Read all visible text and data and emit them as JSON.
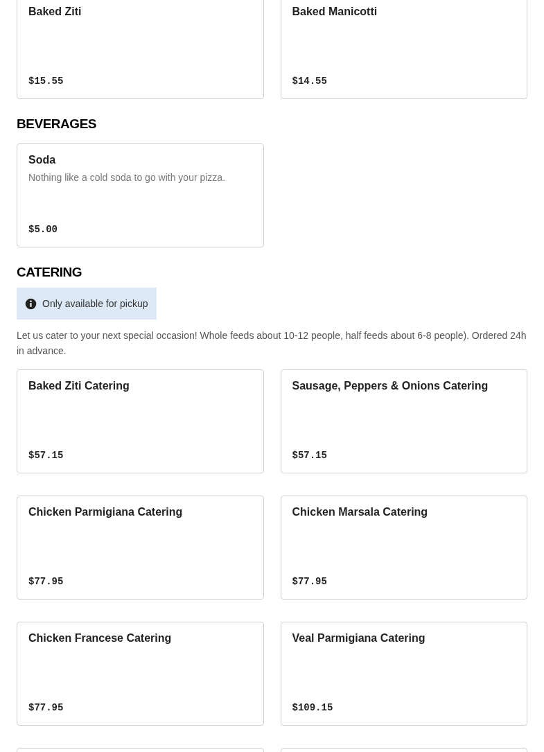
{
  "sections": [
    {
      "items": [
        {
          "kind": "item",
          "name": "Baked Ziti",
          "price": "$15.55"
        },
        {
          "kind": "item",
          "name": "Baked Manicotti",
          "price": "$14.55"
        }
      ]
    },
    {
      "title": "BEVERAGES",
      "items": [
        {
          "kind": "item",
          "name": "Soda",
          "description": "Nothing like a cold soda to go with your pizza.",
          "price": "$5.00"
        }
      ]
    },
    {
      "title": "CATERING",
      "notice": "Only available for pickup",
      "description": "Let us cater to your next special occasion! Whole feeds about 10-12 people, half feeds about 6-8 people). Ordered 24h in advance.",
      "items": [
        {
          "kind": "item",
          "name": "Baked Ziti Catering",
          "price": "$57.15"
        },
        {
          "kind": "item",
          "name": "Sausage, Peppers & Onions Catering",
          "price": "$57.15"
        },
        {
          "kind": "item",
          "name": "Chicken Parmigiana Catering",
          "price": "$77.95"
        },
        {
          "kind": "item",
          "name": "Chicken Marsala Catering",
          "price": "$77.95"
        },
        {
          "kind": "item",
          "name": "Chicken Francese Catering",
          "price": "$77.95"
        },
        {
          "kind": "item",
          "name": "Veal Parmigiana Catering",
          "price": "$109.15"
        },
        {
          "kind": "partial"
        },
        {
          "kind": "partial"
        }
      ]
    }
  ]
}
